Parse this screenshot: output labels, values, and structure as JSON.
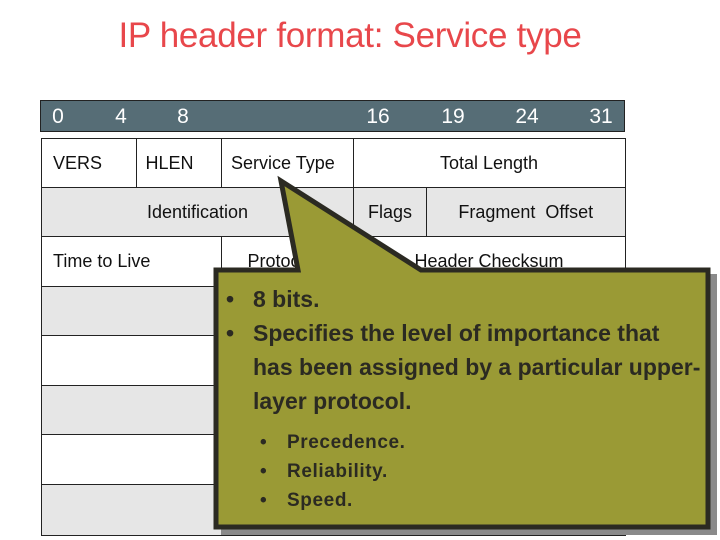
{
  "title": "IP header format: Service type",
  "colors": {
    "title": "#e8474b",
    "ruler_bg": "#566d76",
    "callout_fill": "#9a9a35",
    "callout_border": "#2b2a22",
    "row_grey": "#e6e6e6"
  },
  "bit_ruler": [
    "0",
    "4",
    "8",
    "16",
    "19",
    "24",
    "31"
  ],
  "header_rows": [
    {
      "fields": [
        "VERS",
        "HLEN",
        "Service Type",
        "Total Length"
      ]
    },
    {
      "fields": [
        "Identification",
        "Flags",
        "Fragment  Offset"
      ]
    },
    {
      "fields": [
        "Time to Live",
        "Protocol",
        "Header Checksum"
      ]
    }
  ],
  "callout": {
    "points": [
      "8 bits.",
      "Specifies the level of importance that has been assigned by a particular upper-layer protocol."
    ],
    "subpoints": [
      "Precedence.",
      "Reliability.",
      "Speed."
    ]
  }
}
